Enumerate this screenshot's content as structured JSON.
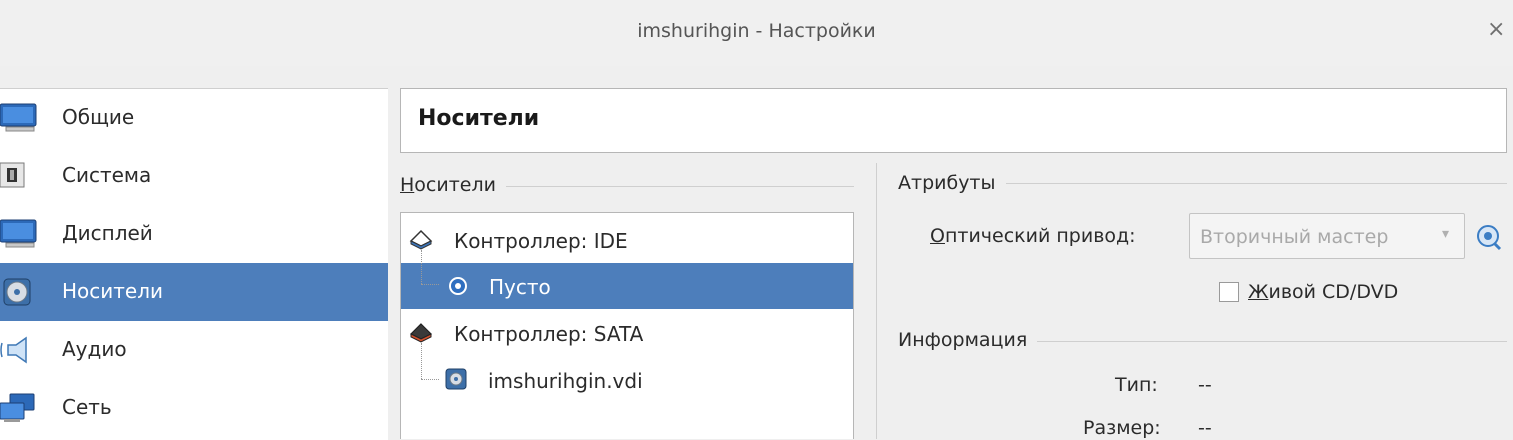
{
  "window": {
    "title": "imshurihgin - Настройки",
    "close_glyph": "×"
  },
  "sidebar": {
    "items": [
      {
        "label": "Общие",
        "icon": "monitor-icon",
        "selected": false
      },
      {
        "label": "Система",
        "icon": "motherboard-icon",
        "selected": false
      },
      {
        "label": "Дисплей",
        "icon": "display-icon",
        "selected": false
      },
      {
        "label": "Носители",
        "icon": "storage-disc-icon",
        "selected": true
      },
      {
        "label": "Аудио",
        "icon": "speaker-icon",
        "selected": false
      },
      {
        "label": "Сеть",
        "icon": "network-icon",
        "selected": false
      }
    ]
  },
  "page": {
    "title": "Носители"
  },
  "storage": {
    "group_title_mnemonic": "Н",
    "group_title_rest": "осители",
    "tree": [
      {
        "label": "Контроллер: IDE",
        "icon": "ide-controller-icon",
        "level": 0,
        "selected": false
      },
      {
        "label": "Пусто",
        "icon": "optical-disc-icon",
        "level": 1,
        "selected": true
      },
      {
        "label": "Контроллер: SATA",
        "icon": "sata-controller-icon",
        "level": 0,
        "selected": false
      },
      {
        "label": "imshurihgin.vdi",
        "icon": "hard-disk-icon",
        "level": 1,
        "selected": false
      }
    ]
  },
  "attributes": {
    "group_title": "Атрибуты",
    "optical_drive_label_mnemonic": "О",
    "optical_drive_label_rest": "птический привод:",
    "optical_drive_value": "Вторичный мастер",
    "live_cd_mnemonic": "Ж",
    "live_cd_rest": "ивой CD/DVD",
    "live_cd_checked": false
  },
  "information": {
    "group_title": "Информация",
    "type_label": "Тип:",
    "type_value": "--",
    "size_label": "Размер:",
    "size_value": "--"
  },
  "colors": {
    "selection": "#4d7ebb",
    "window_bg": "#efefef"
  }
}
